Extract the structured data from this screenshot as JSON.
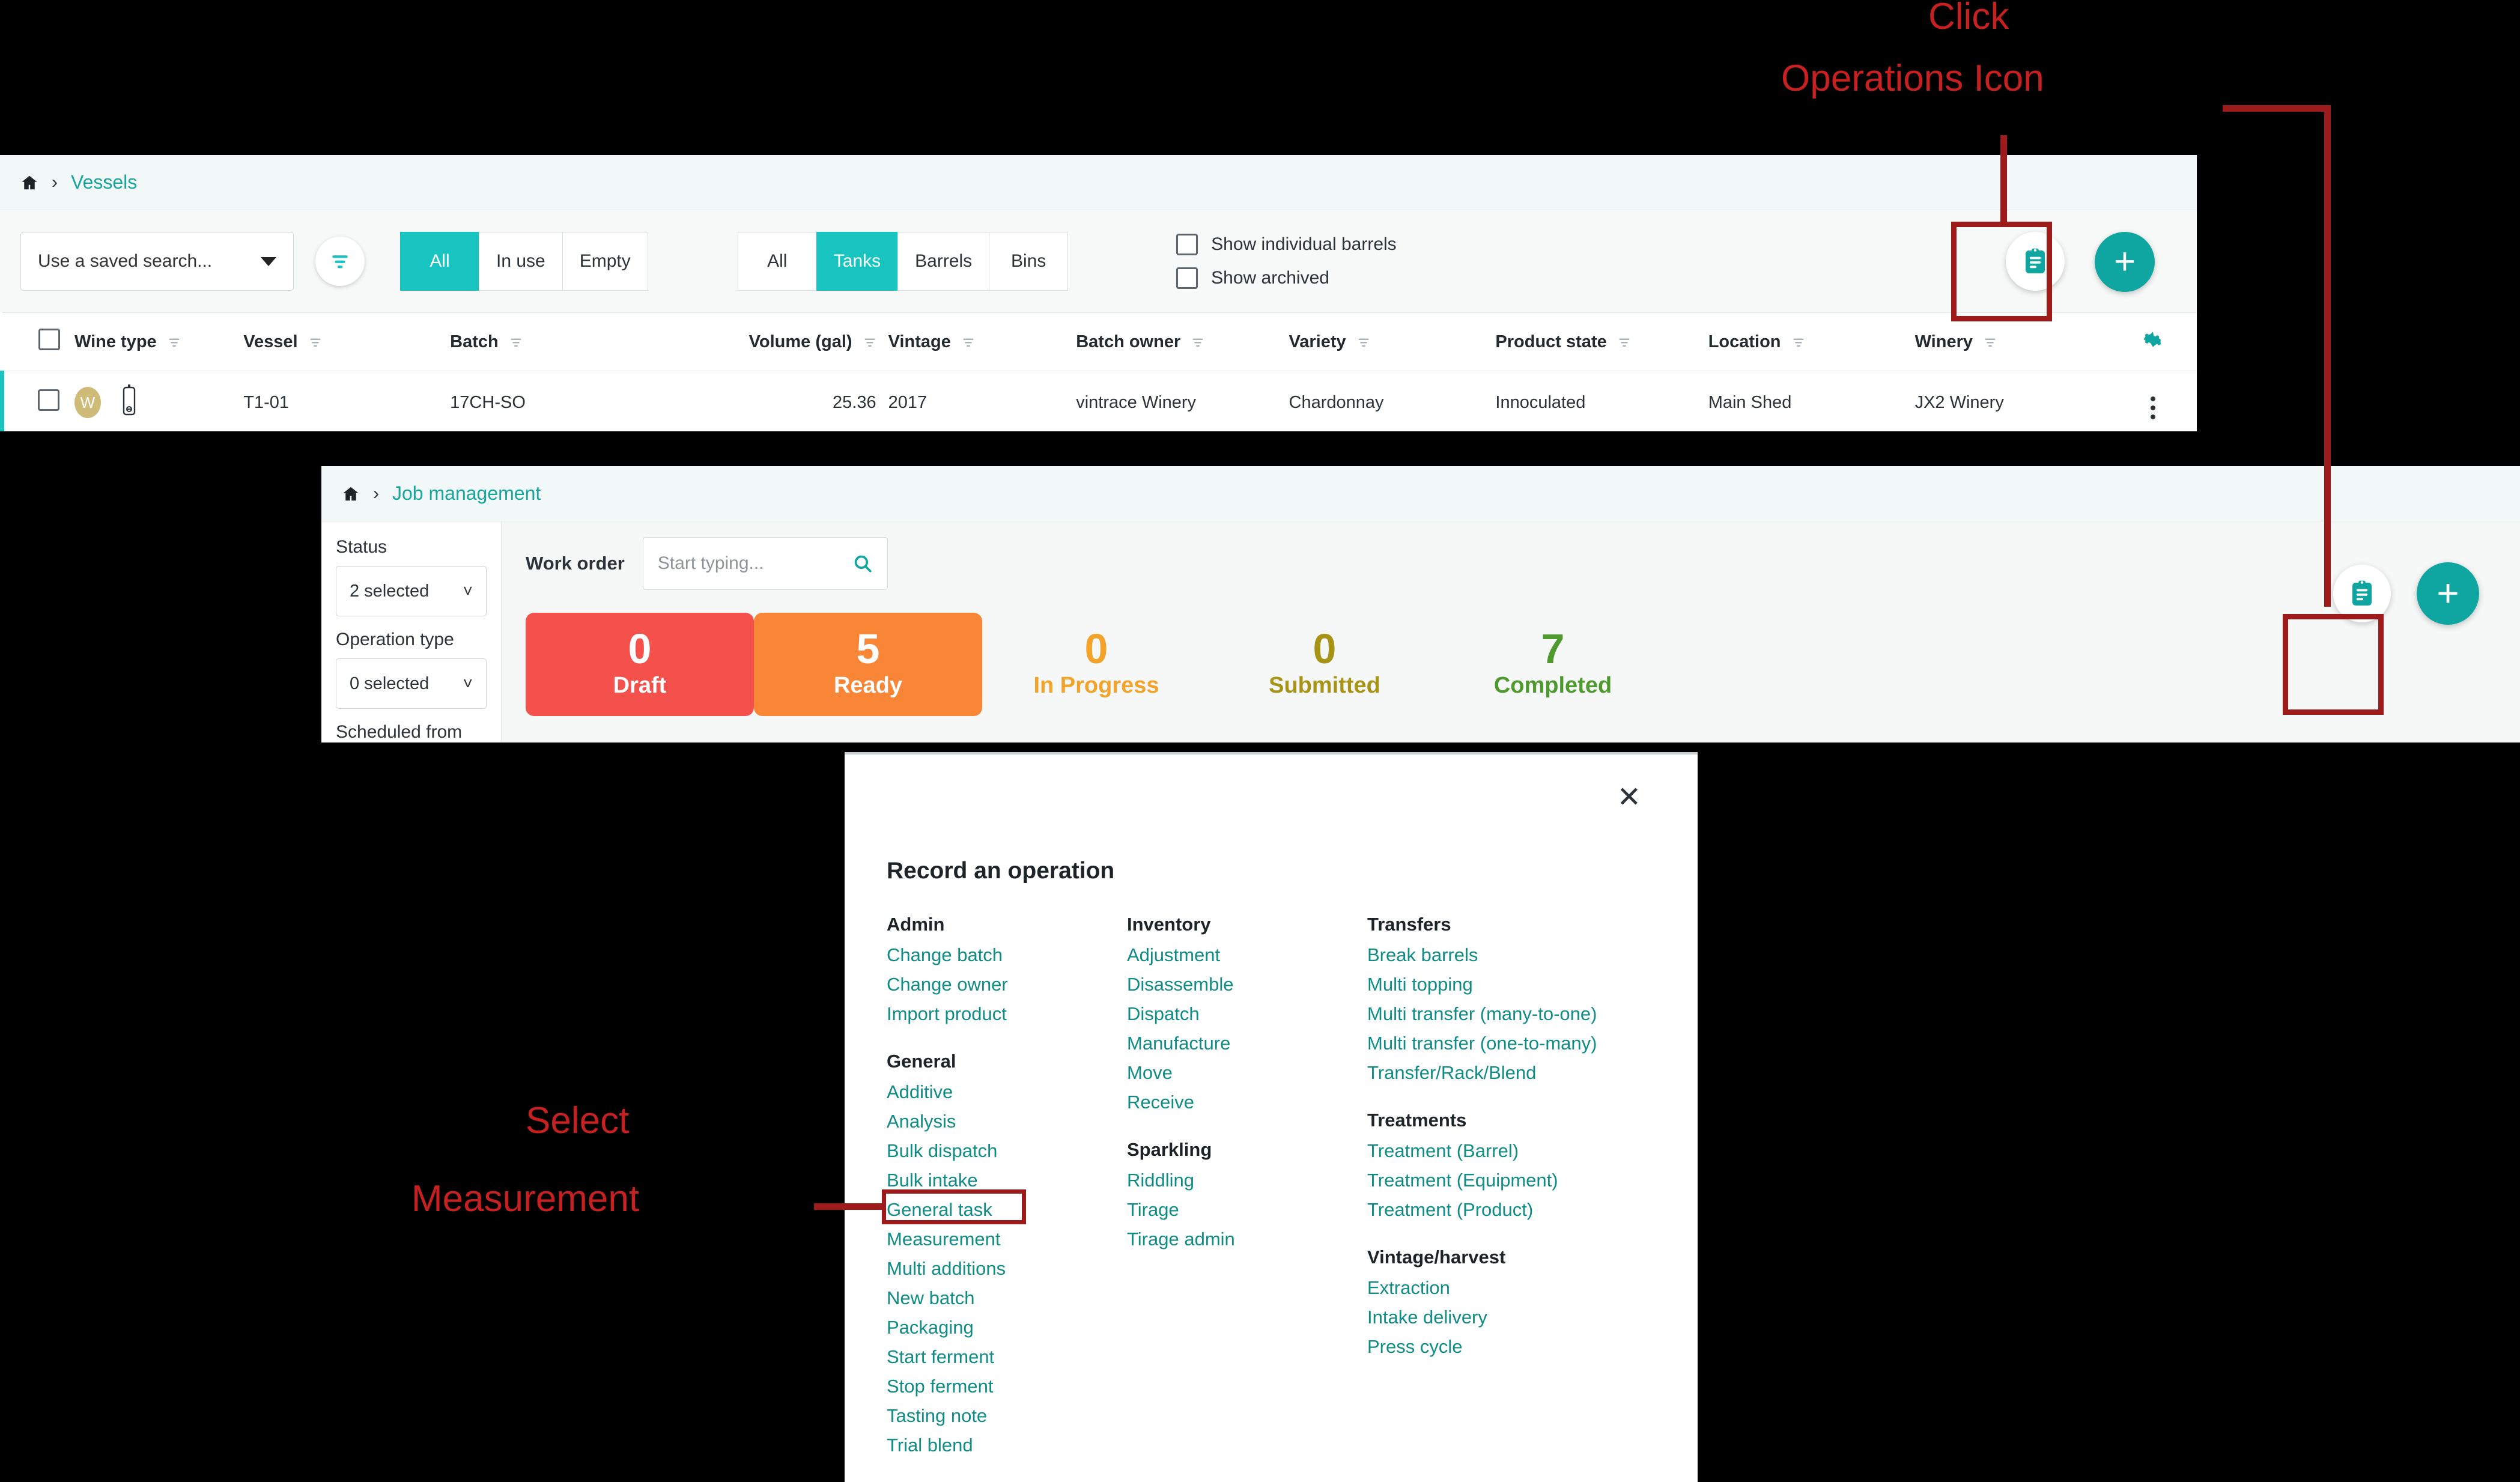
{
  "colors": {
    "teal": "#0FA5A0",
    "teal_bright": "#17C4C0",
    "link_teal": "#0F8C86",
    "annotation_red": "#C62020",
    "annotation_box": "#9E1B1B",
    "draft_red": "#F4504C",
    "ready_orange": "#F98536",
    "inprogress_orange": "#F3A22A",
    "submitted_olive": "#A79417",
    "completed_green": "#4E9A2F"
  },
  "annotations": [
    {
      "id": "click-ops",
      "line1": "Click",
      "line2": "Operations Icon"
    },
    {
      "id": "select-measurement",
      "line1": "Select",
      "line2": "Measurement"
    }
  ],
  "vessels_panel": {
    "breadcrumb": {
      "home_icon": "home-icon",
      "separator": "›",
      "current": "Vessels"
    },
    "toolbar": {
      "saved_search_value": "Use a saved search...",
      "filter_icon": "filter-icon",
      "usage_segments": [
        {
          "label": "All",
          "active": true
        },
        {
          "label": "In use",
          "active": false
        },
        {
          "label": "Empty",
          "active": false
        }
      ],
      "type_segments": [
        {
          "label": "All",
          "active": false
        },
        {
          "label": "Tanks",
          "active": true
        },
        {
          "label": "Barrels",
          "active": false
        },
        {
          "label": "Bins",
          "active": false
        }
      ],
      "checkboxes": [
        {
          "label": "Show individual barrels",
          "checked": false
        },
        {
          "label": "Show archived",
          "checked": false
        }
      ],
      "operations_icon": "clipboard-operations-icon",
      "add_icon": "plus-icon"
    },
    "table": {
      "gear_icon": "gear-icon",
      "columns": [
        {
          "label": "Wine type",
          "align": "left"
        },
        {
          "label": "Vessel",
          "align": "left"
        },
        {
          "label": "Batch",
          "align": "left"
        },
        {
          "label": "Volume (gal)",
          "align": "right"
        },
        {
          "label": "Vintage",
          "align": "left"
        },
        {
          "label": "Batch owner",
          "align": "left"
        },
        {
          "label": "Variety",
          "align": "left"
        },
        {
          "label": "Product state",
          "align": "left"
        },
        {
          "label": "Location",
          "align": "left"
        },
        {
          "label": "Winery",
          "align": "left"
        }
      ],
      "rows": [
        {
          "wine_type_badge": "W",
          "vessel": "T1-01",
          "batch": "17CH-SO",
          "volume": "25.36",
          "vintage": "2017",
          "batch_owner": "vintrace Winery",
          "variety": "Chardonnay",
          "product_state": "Innoculated",
          "location": "Main Shed",
          "winery": "JX2 Winery"
        }
      ]
    }
  },
  "job_panel": {
    "breadcrumb": {
      "home_icon": "home-icon",
      "separator": "›",
      "current": "Job management"
    },
    "filters": [
      {
        "label": "Status",
        "value": "2 selected"
      },
      {
        "label": "Operation type",
        "value": "0 selected"
      },
      {
        "label": "Scheduled from",
        "value": ""
      }
    ],
    "work_order": {
      "label": "Work order",
      "placeholder": "Start typing...",
      "value": "",
      "search_icon": "search-icon"
    },
    "status_cards": [
      {
        "count": "0",
        "label": "Draft",
        "style": "filled",
        "bg": "#F4504C",
        "fg": "#ffffff"
      },
      {
        "count": "5",
        "label": "Ready",
        "style": "filled",
        "bg": "#F98536",
        "fg": "#ffffff"
      },
      {
        "count": "0",
        "label": "In Progress",
        "style": "plain",
        "bg": "transparent",
        "fg": "#F3A22A"
      },
      {
        "count": "0",
        "label": "Submitted",
        "style": "plain",
        "bg": "transparent",
        "fg": "#A79417"
      },
      {
        "count": "7",
        "label": "Completed",
        "style": "plain",
        "bg": "transparent",
        "fg": "#4E9A2F"
      }
    ],
    "operations_icon": "clipboard-operations-icon",
    "add_icon": "plus-icon"
  },
  "modal": {
    "title": "Record an operation",
    "close_icon": "close-icon",
    "columns": [
      {
        "groups": [
          {
            "heading": "Admin",
            "items": [
              "Change batch",
              "Change owner",
              "Import product"
            ]
          },
          {
            "heading": "General",
            "items": [
              "Additive",
              "Analysis",
              "Bulk dispatch",
              "Bulk intake",
              "General task",
              "Measurement",
              "Multi additions",
              "New batch",
              "Packaging",
              "Start ferment",
              "Stop ferment",
              "Tasting note",
              "Trial blend"
            ],
            "highlight": "Measurement"
          }
        ]
      },
      {
        "groups": [
          {
            "heading": "Inventory",
            "items": [
              "Adjustment",
              "Disassemble",
              "Dispatch",
              "Manufacture",
              "Move",
              "Receive"
            ]
          },
          {
            "heading": "Sparkling",
            "items": [
              "Riddling",
              "Tirage",
              "Tirage admin"
            ]
          }
        ]
      },
      {
        "groups": [
          {
            "heading": "Transfers",
            "items": [
              "Break barrels",
              "Multi topping",
              "Multi transfer (many-to-one)",
              "Multi transfer (one-to-many)",
              "Transfer/Rack/Blend"
            ]
          },
          {
            "heading": "Treatments",
            "items": [
              "Treatment (Barrel)",
              "Treatment (Equipment)",
              "Treatment (Product)"
            ]
          },
          {
            "heading": "Vintage/harvest",
            "items": [
              "Extraction",
              "Intake delivery",
              "Press cycle"
            ]
          }
        ]
      }
    ]
  }
}
